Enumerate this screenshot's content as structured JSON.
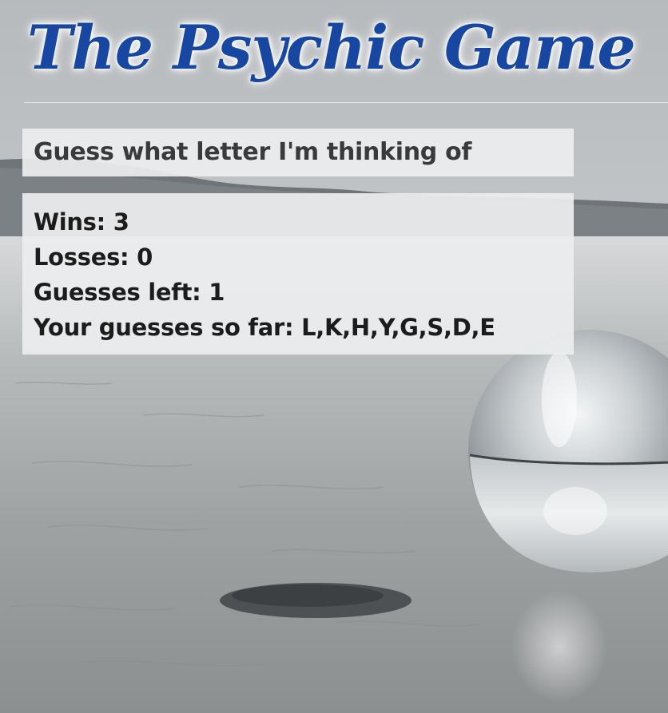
{
  "header": {
    "title": "The Psychic Game"
  },
  "prompt": {
    "text": "Guess what letter I'm thinking of"
  },
  "stats": {
    "wins_label": "Wins:",
    "wins": "3",
    "losses_label": "Losses:",
    "losses": "0",
    "guesses_left_label": "Guesses left:",
    "guesses_left": "1",
    "guesses_so_far_label": "Your guesses so far:",
    "guesses_so_far": "L,K,H,Y,G,S,D,E"
  },
  "colors": {
    "title": "#1747a0",
    "panel_bg": "#ecedee",
    "text": "#1c1c1c"
  },
  "background": {
    "description_icon": "crystal-ball-on-beach-photo"
  }
}
